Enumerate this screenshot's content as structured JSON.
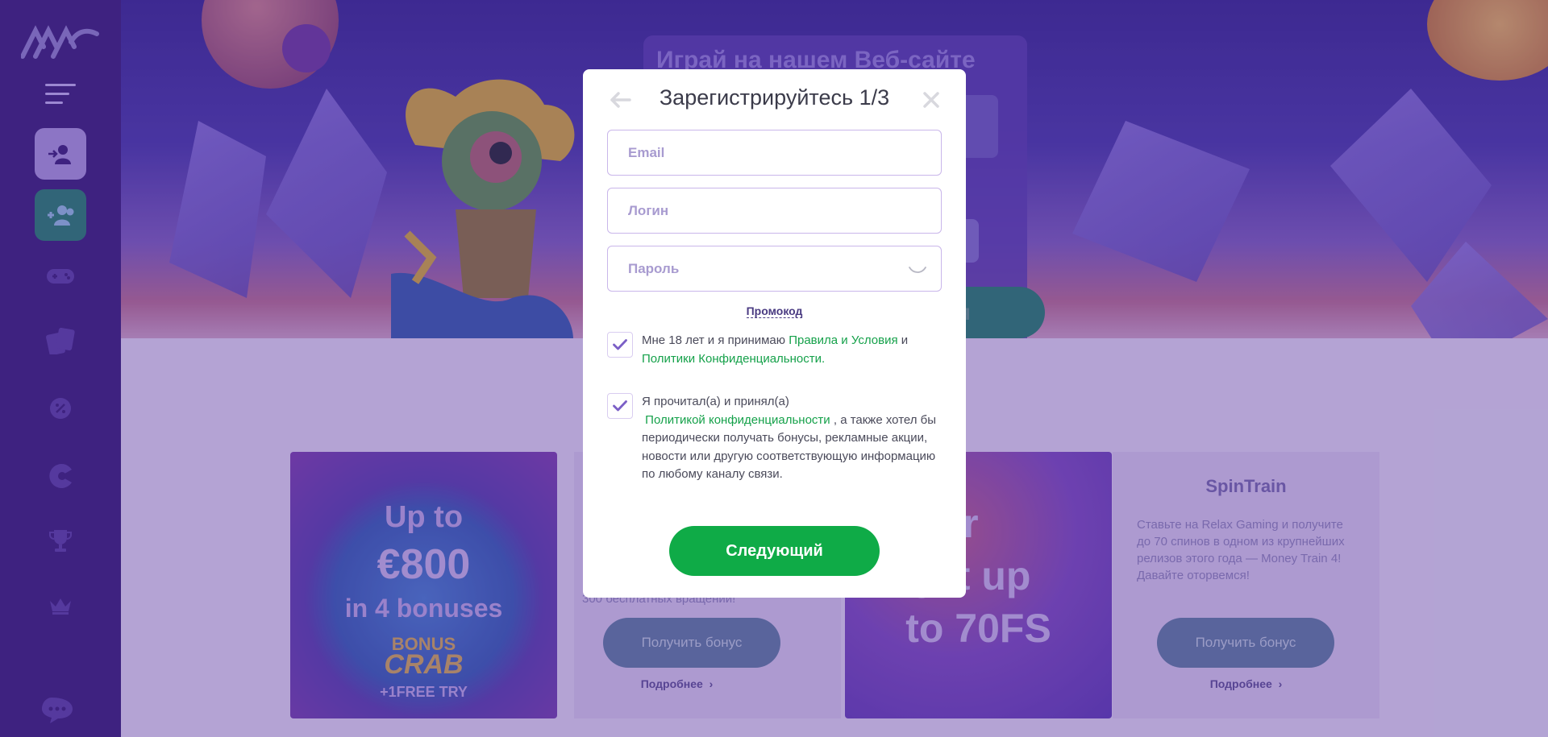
{
  "hero": {
    "title": "Играй на нашем Веб-сайте",
    "cta_partial": "ся"
  },
  "promos": {
    "promo1": {
      "line1": "Up to",
      "line2": "€800",
      "line3": "in 4 bonuses",
      "badge_top": "BONUS",
      "badge_mid": "CRAB",
      "badge_bottom": "+1FREE TRY"
    },
    "promo2": {
      "line1": "ager",
      "line2": "o get up",
      "line3": "to 70FS"
    }
  },
  "cards": {
    "card1": {
      "desc_partial": "300 бесплатных вращений!",
      "button": "Получить бонус",
      "more": "Подробнее"
    },
    "card2": {
      "title": "SpinTrain",
      "desc": "Ставьте на Relax Gaming и получите до 70 спинов в одном из крупнейших релизов этого года — Money Train 4! Давайте оторвемся!",
      "button": "Получить бонус",
      "more": "Подробнее"
    }
  },
  "modal": {
    "title": "Зарегистрируйтесь 1/3",
    "email_placeholder": "Email",
    "login_placeholder": "Логин",
    "password_placeholder": "Пароль",
    "promo_link": "Промокод",
    "consent1": {
      "prefix": "Мне 18 лет и я принимаю ",
      "link1": "Правила и Условия",
      "middle": " и ",
      "link2": "Политики Конфиденциальности.",
      "checked": true
    },
    "consent2": {
      "prefix": "Я прочитал(а) и принял(а)",
      "link": "Политикой конфиденциальности",
      "suffix": " , а также хотел бы периодически получать бонусы, рекламные акции, новости или другую соответствующую информацию по любому каналу связи.",
      "checked": true
    },
    "next_button": "Следующий"
  },
  "colors": {
    "sidebar": "#3b2178",
    "primary_green": "#0fab47",
    "link_green": "#15a14a",
    "checkmark": "#7b5fc6",
    "field_border": "#c9b6ea"
  },
  "icons": {
    "sidebar": [
      "logo",
      "menu-icon",
      "login-icon",
      "register-icon",
      "gamepad-icon",
      "cards-icon",
      "promo-icon",
      "pacman-icon",
      "trophy-icon",
      "crown-icon",
      "chat-icon"
    ],
    "modal": [
      "back-arrow-icon",
      "close-icon",
      "eye-icon",
      "checkmark-icon"
    ]
  }
}
